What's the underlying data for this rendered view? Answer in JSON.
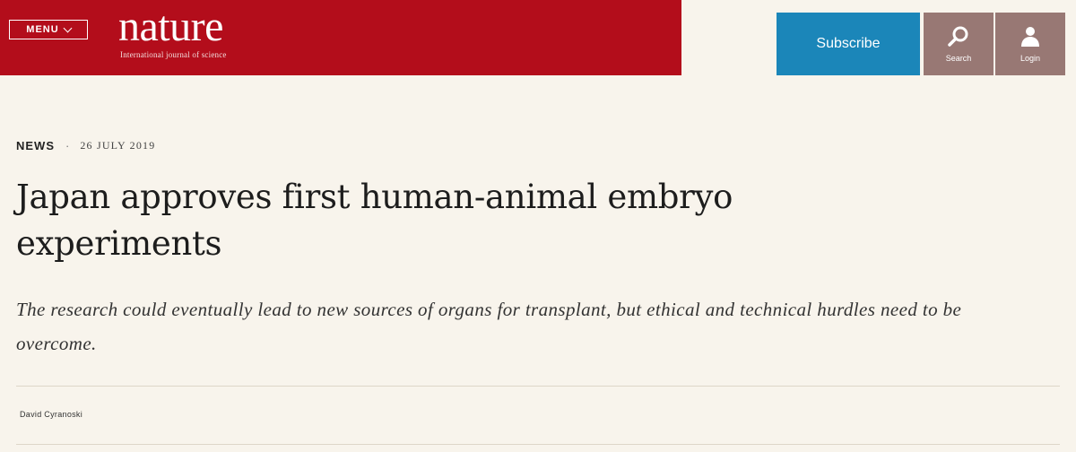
{
  "header": {
    "menu_label": "MENU",
    "logo_text": "nature",
    "tagline": "International journal of science",
    "brand_color": "#b30d1b",
    "subscribe_label": "Subscribe",
    "subscribe_color": "#1b86b9",
    "search_label": "Search",
    "login_label": "Login",
    "icon_button_color": "#987874",
    "icons": [
      "chevron-down-icon",
      "search-icon",
      "user-icon"
    ]
  },
  "article": {
    "section": "NEWS",
    "separator": "·",
    "date": "26 JULY 2019",
    "title": "Japan approves first human-animal embryo experiments",
    "standfirst": "The research could eventually lead to new sources of organs for transplant, but ethical and technical hurdles need to be overcome.",
    "author": "David Cyranoski"
  }
}
